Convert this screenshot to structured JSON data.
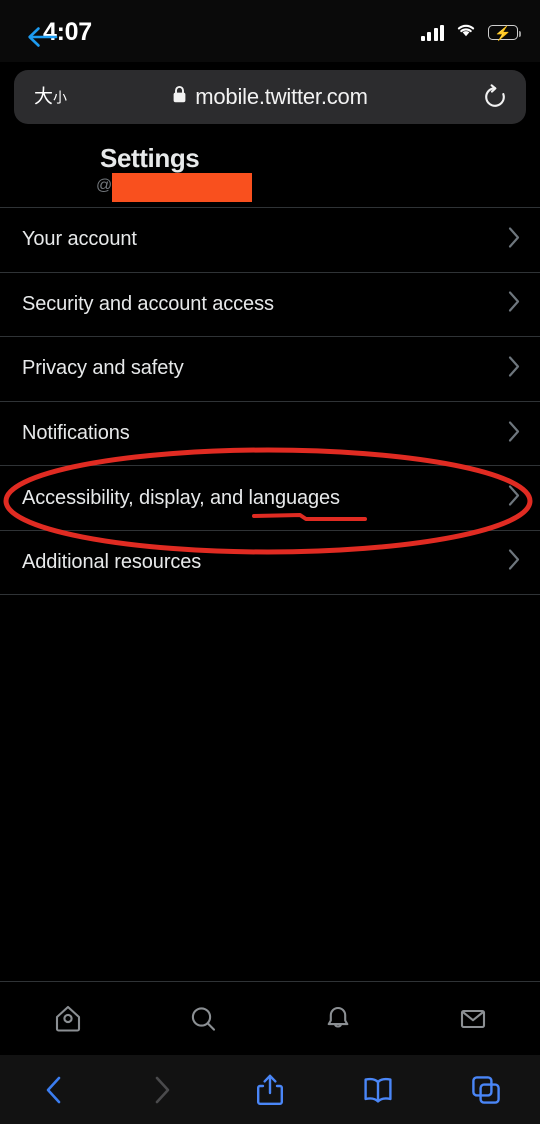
{
  "status_bar": {
    "time": "4:07",
    "signal_icon": "cellular-signal-icon",
    "wifi_icon": "wifi-icon",
    "battery_icon": "battery-charging-icon",
    "battery_color": "#34c759"
  },
  "browser": {
    "aa_label_large": "大",
    "aa_label_small": "小",
    "lock_icon": "lock-icon",
    "url": "mobile.twitter.com",
    "reload_icon": "reload-icon",
    "bar_background": "#2c2c2e",
    "toolbar": [
      {
        "name": "back-button",
        "icon": "chevron-left-icon",
        "enabled": true,
        "color": "#3b7df0"
      },
      {
        "name": "forward-button",
        "icon": "chevron-right-icon",
        "enabled": false,
        "color": "#4a4a4c"
      },
      {
        "name": "share-button",
        "icon": "share-icon",
        "enabled": true,
        "color": "#4a86f7"
      },
      {
        "name": "bookmarks-button",
        "icon": "book-icon",
        "enabled": true,
        "color": "#4a86f7"
      },
      {
        "name": "tabs-button",
        "icon": "tabs-icon",
        "enabled": true,
        "color": "#4a86f7"
      }
    ]
  },
  "header": {
    "back_icon": "arrow-left-icon",
    "back_color": "#1d9bf0",
    "title": "Settings",
    "handle_prefix": "@",
    "handle_redacted": true,
    "redaction_color": "#f9501e"
  },
  "settings": {
    "items": [
      {
        "label": "Your account",
        "chevron": "chevron-right-icon"
      },
      {
        "label": "Security and account access",
        "chevron": "chevron-right-icon"
      },
      {
        "label": "Privacy and safety",
        "chevron": "chevron-right-icon"
      },
      {
        "label": "Notifications",
        "chevron": "chevron-right-icon"
      },
      {
        "label": "Accessibility, display, and languages",
        "chevron": "chevron-right-icon"
      },
      {
        "label": "Additional resources",
        "chevron": "chevron-right-icon"
      }
    ]
  },
  "annotations": {
    "color": "#e02b22",
    "ellipse_target": "Accessibility, display, and languages",
    "underline_target": "languages"
  },
  "tab_bar": {
    "items": [
      {
        "name": "tab-home",
        "icon": "home-icon"
      },
      {
        "name": "tab-search",
        "icon": "search-icon"
      },
      {
        "name": "tab-notifications",
        "icon": "bell-icon"
      },
      {
        "name": "tab-messages",
        "icon": "envelope-icon"
      }
    ],
    "icon_color": "#8b8f93"
  }
}
